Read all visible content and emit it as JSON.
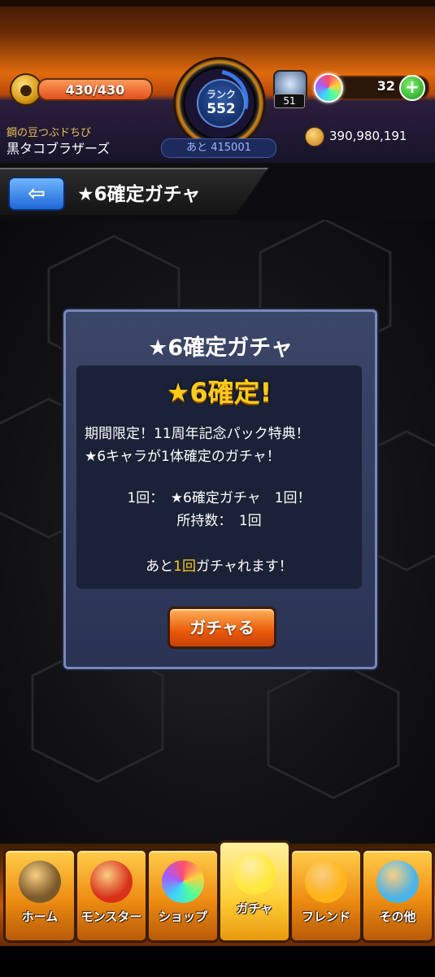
{
  "header": {
    "stamina": "430/430",
    "stamina_fraction": 1.0,
    "rank_label": "ランク",
    "rank_value": "552",
    "rank_next": "あと 415001",
    "box_count": "51",
    "orb_count": "32",
    "plus_label": "+",
    "player_title": "鋼の豆つぶドちび",
    "player_name": "黒タコブラザーズ",
    "coins": "390,980,191"
  },
  "titlebar": {
    "back_label": "⇦",
    "title": "★6確定ガチャ"
  },
  "dialog": {
    "title": "★6確定ガチャ",
    "headline": "★6確定!",
    "desc_line1": "期間限定！11周年記念パック特典！",
    "desc_line2": "★6キャラが1体確定のガチャ！",
    "count_line": "1回：　★6確定ガチャ　1回！",
    "owned_line": "所持数：　1回",
    "remaining_prefix": "あと",
    "remaining_value": "1回",
    "remaining_suffix": "ガチャれます！",
    "button_label": "ガチャる"
  },
  "nav": {
    "items": [
      {
        "label": "ホーム",
        "icon": "home-icon",
        "color": "#7a5a2a"
      },
      {
        "label": "モンスター",
        "icon": "monster-icon",
        "color": "#d8321a"
      },
      {
        "label": "ショップ",
        "icon": "orb-icon",
        "color": "#8a5cff"
      },
      {
        "label": "ガチャ",
        "icon": "gacha-egg-icon",
        "color": "#ffe83a"
      },
      {
        "label": "フレンド",
        "icon": "friends-icon",
        "color": "#ffb418"
      },
      {
        "label": "その他",
        "icon": "other-icon",
        "color": "#4ab4e8"
      }
    ],
    "active_index": 3
  }
}
